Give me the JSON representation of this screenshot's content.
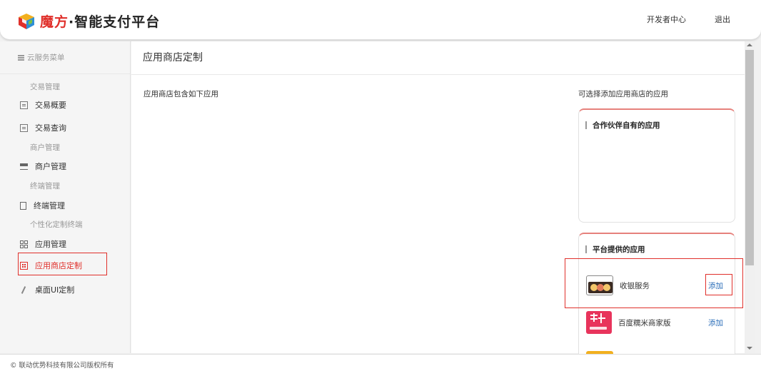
{
  "header": {
    "brand_name": "魔方",
    "separator_title": "·智能支付平台",
    "developer_link": "开发者中心",
    "logout_link": "退出"
  },
  "sidebar": {
    "title": "云服务菜单",
    "groups": [
      {
        "label": "交易管理",
        "items": [
          {
            "label": "交易概要",
            "icon": "document-icon"
          },
          {
            "label": "交易查询",
            "icon": "list-icon"
          }
        ]
      },
      {
        "label": "商户管理",
        "items": [
          {
            "label": "商户管理",
            "icon": "store-icon"
          }
        ]
      },
      {
        "label": "终端管理",
        "items": [
          {
            "label": "终端管理",
            "icon": "terminal-icon"
          }
        ]
      },
      {
        "label": "个性化定制终端",
        "items": [
          {
            "label": "应用管理",
            "icon": "grid-icon"
          },
          {
            "label": "应用商店定制",
            "icon": "app-grid-icon",
            "active": true
          },
          {
            "label": "桌面UI定制",
            "icon": "brush-icon"
          }
        ]
      }
    ]
  },
  "main": {
    "title": "应用商店定制",
    "included_label": "应用商店包含如下应用",
    "available_label": "可选择添加应用商店的应用",
    "partner_panel_title": "合作伙伴自有的应用",
    "platform_panel_title": "平台提供的应用",
    "apps": [
      {
        "name": "收银服务",
        "action": "添加",
        "icon": "cashier-app-icon"
      },
      {
        "name": "百度糯米商家版",
        "action": "添加",
        "icon": "nuomi-app-icon"
      }
    ]
  },
  "footer": {
    "copyright": "© 联动优势科技有限公司版权所有"
  },
  "colors": {
    "brand_red": "#e0302b",
    "link_blue": "#2a6db8",
    "panel_top_accent": "#e6817c"
  }
}
